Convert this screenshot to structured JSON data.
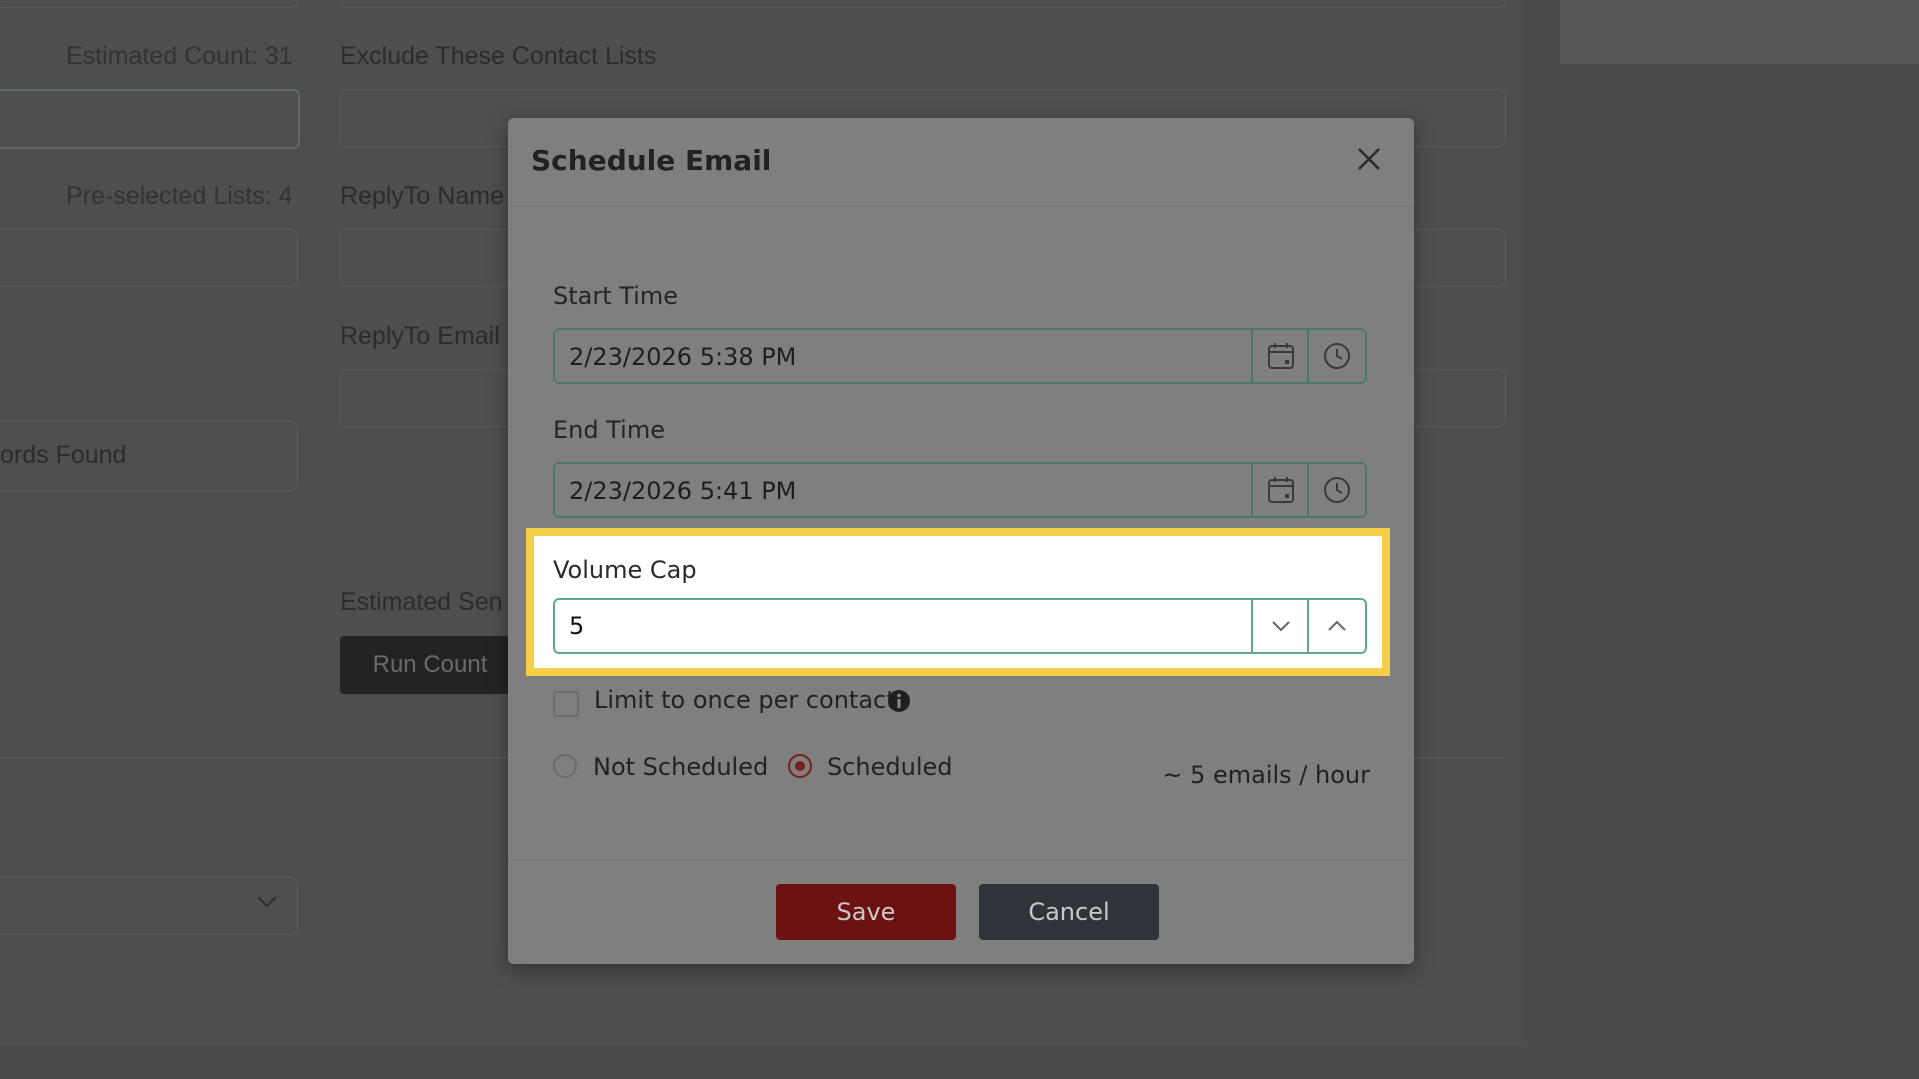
{
  "background": {
    "estimated_count": "Estimated Count: 31",
    "exclude_lists_label": "Exclude These Contact Lists",
    "preselected_lists": "Pre-selected Lists: 4",
    "replyto_name_label": "ReplyTo Name",
    "replyto_email_label": "ReplyTo Email",
    "records_found": "ords Found",
    "estimated_send_label": "Estimated Sen",
    "run_count_button": "Run Count"
  },
  "modal": {
    "title": "Schedule Email",
    "start_time": {
      "label": "Start Time",
      "value": "2/23/2026 5:38 PM"
    },
    "end_time": {
      "label": "End Time",
      "value": "2/23/2026 5:41 PM"
    },
    "volume_cap": {
      "label": "Volume Cap",
      "value": "5"
    },
    "limit_once": {
      "label": "Limit to once per contact",
      "checked": false
    },
    "schedule_options": [
      {
        "label": "Not Scheduled",
        "selected": false
      },
      {
        "label": "Scheduled",
        "selected": true
      }
    ],
    "rate_text": "~ 5 emails / hour",
    "save_label": "Save",
    "cancel_label": "Cancel"
  },
  "colors": {
    "highlight": "#f5cf47",
    "save": "#6e1111",
    "cancel": "#2f343a",
    "input_border": "#60a888"
  }
}
